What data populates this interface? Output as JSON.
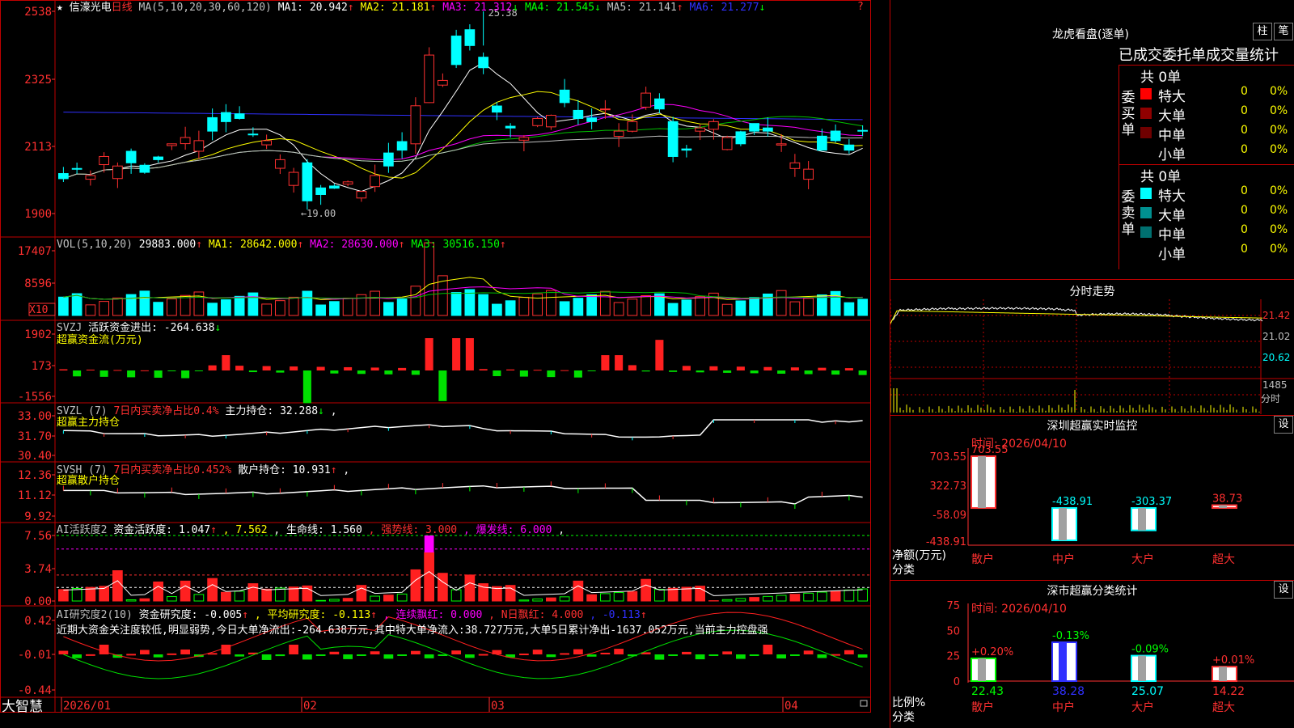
{
  "app": {
    "brand": "大智慧"
  },
  "stock": {
    "name": "信濠光电",
    "period": "日线"
  },
  "x_axis": {
    "labels": [
      "2026/01",
      "02",
      "03",
      "04"
    ]
  },
  "panels": {
    "kline": {
      "axis": [
        "2538",
        "2325",
        "2113",
        "1900"
      ],
      "hi_note": "25.38",
      "lo_note": "19.00",
      "legend": [
        {
          "t": "MA(5,10,20,30,60,120)",
          "c": "#c0c0c0"
        },
        {
          "t": "MA1: 20.942",
          "c": "#ffffff",
          "a": "up"
        },
        {
          "t": "MA2: 21.181",
          "c": "#ffff00",
          "a": "up"
        },
        {
          "t": "MA3: 21.312",
          "c": "#ff00ff",
          "a": "down"
        },
        {
          "t": "MA4: 21.545",
          "c": "#00ff00",
          "a": "down"
        },
        {
          "t": "MA5: 21.141",
          "c": "#c0c0c0",
          "a": "up"
        },
        {
          "t": "MA6: 21.277",
          "c": "#3030ff",
          "a": "down"
        }
      ]
    },
    "vol": {
      "axis": [
        "17407",
        "8596"
      ],
      "unit": "X10",
      "legend": [
        {
          "t": "VOL(5,10,20)",
          "c": "#c0c0c0"
        },
        {
          "t": "29883.000",
          "c": "#ffffff",
          "a": "up"
        },
        {
          "t": "MA1: 28642.000",
          "c": "#ffff00",
          "a": "up"
        },
        {
          "t": "MA2: 28630.000",
          "c": "#ff00ff",
          "a": "up"
        },
        {
          "t": "MA3: 30516.150",
          "c": "#00ff00",
          "a": "up"
        }
      ]
    },
    "svzj": {
      "axis": [
        "1902",
        "173",
        "-1556"
      ],
      "sub": "超赢资金流(万元)",
      "legend": [
        {
          "t": "SVZJ",
          "c": "#c0c0c0"
        },
        {
          "t": " 活跃资金进出: -264.638",
          "c": "#ffffff",
          "a": "down"
        }
      ]
    },
    "svzl": {
      "axis": [
        "33.00",
        "31.70",
        "30.40"
      ],
      "sub": "超赢主力持仓",
      "legend": [
        {
          "t": "SVZL (7)",
          "c": "#c0c0c0"
        },
        {
          "t": "7日内买卖净占比0.4%",
          "c": "#ff3030"
        },
        {
          "t": "主力持仓: 32.288",
          "c": "#ffffff",
          "a": "down"
        },
        {
          "t": ",",
          "c": "#ffffff"
        }
      ]
    },
    "svsh": {
      "axis": [
        "12.36",
        "11.12",
        "9.92"
      ],
      "sub": "超赢散户持仓",
      "legend": [
        {
          "t": "SVSH (7)",
          "c": "#c0c0c0"
        },
        {
          "t": "7日内买卖净占比0.452%",
          "c": "#ff3030"
        },
        {
          "t": "散户持仓: 10.931",
          "c": "#ffffff",
          "a": "up"
        },
        {
          "t": ",",
          "c": "#ffffff"
        }
      ]
    },
    "ai1": {
      "axis": [
        "7.56",
        "3.74",
        "0.00"
      ],
      "legend": [
        {
          "t": "AI活跃度2",
          "c": "#c0c0c0"
        },
        {
          "t": "资金活跃度: 1.047",
          "c": "#ffffff",
          "a": "up"
        },
        {
          "t": ", 7.562",
          "c": "#ffff00"
        },
        {
          "t": ", 生命线: 1.560",
          "c": "#ffffff"
        },
        {
          "t": ", 强势线: 3.000",
          "c": "#ff3030"
        },
        {
          "t": ", 爆发线: 6.000",
          "c": "#ff00ff"
        },
        {
          "t": ",",
          "c": "#ffffff"
        }
      ]
    },
    "ai2": {
      "axis": [
        "0.42",
        "-0.01",
        "-0.44"
      ],
      "desc": "近期大资金关注度较低,明显弱势,今日大单净流出:-264.638万元,其中特大单净流入:38.727万元,大单5日累计净出-1637.052万元,当前主力控盘强",
      "legend": [
        {
          "t": "AI研究度2(10)",
          "c": "#c0c0c0"
        },
        {
          "t": "资金研究度: -0.005",
          "c": "#ffffff",
          "a": "up"
        },
        {
          "t": ", 平均研究度: -0.113",
          "c": "#ffff00",
          "a": "up"
        },
        {
          "t": ", 连续飘红: 0.000",
          "c": "#ff00ff"
        },
        {
          "t": ", N日飘红: 4.000",
          "c": "#ff3030"
        },
        {
          "t": ", -0.113",
          "c": "#3030ff",
          "a": "up"
        }
      ]
    }
  },
  "longhu": {
    "title": "龙虎看盘(逐单)",
    "btn_zhu": "柱",
    "btn_bi": "笔",
    "tabs": [
      "已成交",
      "委托单",
      "成交量统计"
    ],
    "buy": {
      "label": "委买单",
      "total": "共 0单",
      "rows": [
        {
          "name": "特大",
          "val": "0",
          "pct": "0%",
          "color": "#ff0000"
        },
        {
          "name": "大单",
          "val": "0",
          "pct": "0%",
          "color": "#900000"
        },
        {
          "name": "中单",
          "val": "0",
          "pct": "0%",
          "color": "#700000"
        },
        {
          "name": "小单",
          "val": "0",
          "pct": "0%",
          "color": "#000000"
        }
      ]
    },
    "sell": {
      "label": "委卖单",
      "total": "共 0单",
      "rows": [
        {
          "name": "特大",
          "val": "0",
          "pct": "0%",
          "color": "#00ffff"
        },
        {
          "name": "大单",
          "val": "0",
          "pct": "0%",
          "color": "#009090"
        },
        {
          "name": "中单",
          "val": "0",
          "pct": "0%",
          "color": "#007070"
        },
        {
          "name": "小单",
          "val": "0",
          "pct": "0%",
          "color": "#000000"
        }
      ]
    }
  },
  "intraday": {
    "title": "分时走势",
    "price_labels": [
      "21.42",
      "21.02",
      "20.62"
    ],
    "vol_label": "1485",
    "vol_unit": "分时"
  },
  "monitor": {
    "title": "深圳超赢实时监控",
    "btn": "设",
    "date": "时间: 2026/04/10",
    "y_labels": [
      "703.55",
      "322.73",
      "-58.09",
      "-438.91"
    ],
    "unit": "净额(万元)",
    "cat_label": "分类",
    "chart_data": {
      "type": "bar",
      "categories": [
        "散户",
        "中户",
        "大户",
        "超大"
      ],
      "values": [
        703.55,
        -438.91,
        -303.37,
        38.73
      ],
      "ylim": [
        -438.91,
        703.55
      ],
      "ylabel": "净额(万元)"
    }
  },
  "classify": {
    "title": "深市超赢分类统计",
    "btn": "设",
    "date": "时间: 2026/04/10",
    "y_labels": [
      "75",
      "50",
      "25",
      "0"
    ],
    "unit": "比例%",
    "cat_label": "分类",
    "chart_data": {
      "type": "bar",
      "categories": [
        "散户",
        "中户",
        "大户",
        "超大"
      ],
      "values": [
        22.43,
        38.28,
        25.07,
        14.22
      ],
      "changes": [
        "+0.20%",
        "-0.13%",
        "-0.09%",
        "+0.01%"
      ],
      "ylim": [
        0,
        75
      ],
      "ylabel": "比例%"
    }
  }
}
